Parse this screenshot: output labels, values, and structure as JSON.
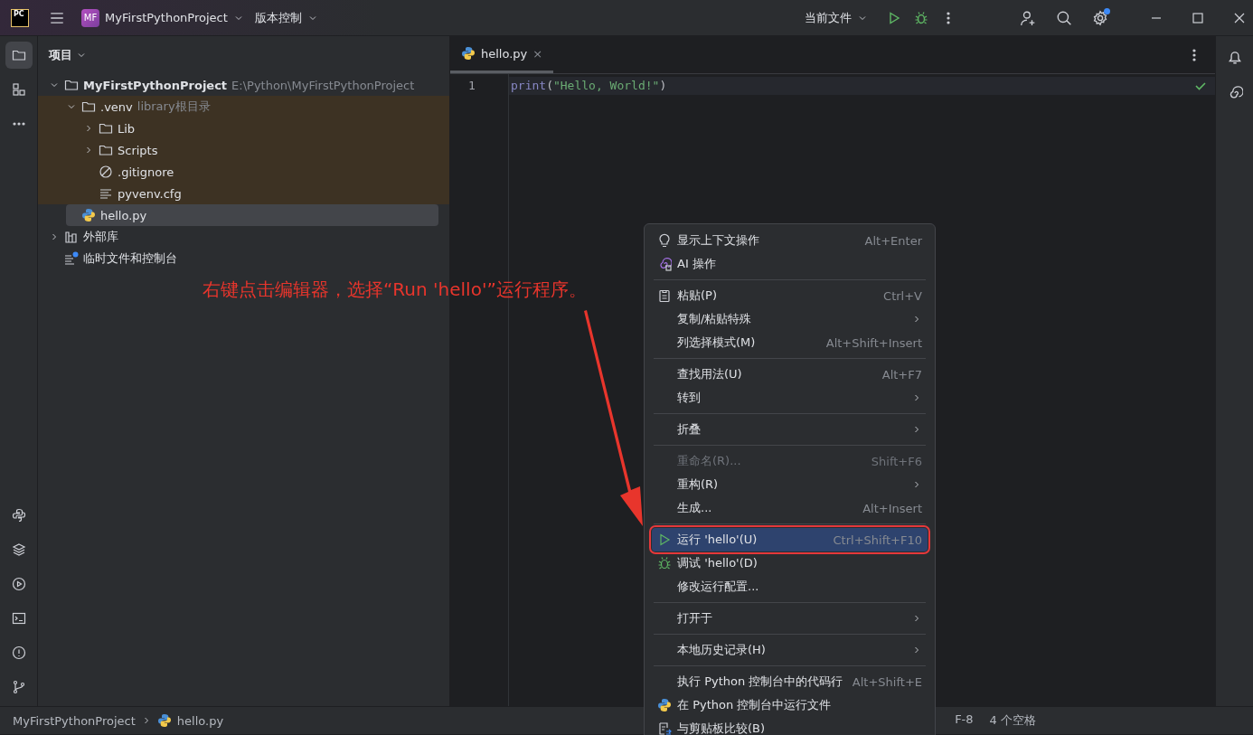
{
  "title_bar": {
    "app_logo": "PC",
    "project_badge": "MF",
    "project": "MyFirstPythonProject",
    "vcs": "版本控制",
    "run_config": "当前文件",
    "settings_badge": true
  },
  "project_panel": {
    "title": "项目",
    "tree": [
      {
        "name": "MyFirstPythonProject",
        "note": "E:\\Python\\MyFirstPythonProject",
        "kind": "project",
        "expanded": true,
        "selected": false,
        "children": [
          {
            "name": ".venv",
            "note": "library根目录",
            "kind": "folder",
            "expanded": true,
            "selected": false,
            "excluded": true,
            "children": [
              {
                "name": "Lib",
                "kind": "folder",
                "expanded": false,
                "selected": false
              },
              {
                "name": "Scripts",
                "kind": "folder",
                "expanded": false,
                "selected": false
              },
              {
                "name": ".gitignore",
                "kind": "ignore",
                "selected": false
              },
              {
                "name": "pyvenv.cfg",
                "kind": "text",
                "selected": false
              }
            ]
          },
          {
            "name": "hello.py",
            "kind": "python",
            "selected": true
          }
        ]
      },
      {
        "name": "外部库",
        "kind": "library",
        "expanded": false,
        "selected": false
      },
      {
        "name": "临时文件和控制台",
        "kind": "scratch",
        "selected": false
      }
    ]
  },
  "editor": {
    "tabs": [
      {
        "label": "hello.py",
        "close": "×",
        "selected": true
      }
    ],
    "lines": [
      {
        "number": "1",
        "tokens": [
          {
            "text": "print",
            "kind": "builtin"
          },
          {
            "text": "(",
            "kind": "plain"
          },
          {
            "text": "\"Hello, World!\"",
            "kind": "string"
          },
          {
            "text": ")",
            "kind": "plain"
          }
        ]
      }
    ]
  },
  "context_menu": {
    "items": [
      {
        "kind": "hint",
        "label": "显示上下文操作",
        "shortcut": "Alt+Enter",
        "submenu": false,
        "disabled": false,
        "selected": false
      },
      {
        "kind": "ai",
        "label": "AI 操作",
        "submenu": false,
        "disabled": false,
        "selected": false
      },
      {
        "kind": "separator"
      },
      {
        "kind": "paste",
        "label": "粘贴(P)",
        "shortcut": "Ctrl+V",
        "submenu": false,
        "disabled": false,
        "selected": false
      },
      {
        "kind": "plain",
        "label": "复制/粘贴特殊",
        "submenu": true,
        "disabled": false,
        "selected": false
      },
      {
        "kind": "plain",
        "label": "列选择模式(M)",
        "shortcut": "Alt+Shift+Insert",
        "submenu": false,
        "disabled": false,
        "selected": false
      },
      {
        "kind": "separator"
      },
      {
        "kind": "plain",
        "label": "查找用法(U)",
        "shortcut": "Alt+F7",
        "submenu": false,
        "disabled": false,
        "selected": false
      },
      {
        "kind": "plain",
        "label": "转到",
        "submenu": true,
        "disabled": false,
        "selected": false
      },
      {
        "kind": "separator"
      },
      {
        "kind": "plain",
        "label": "折叠",
        "submenu": true,
        "disabled": false,
        "selected": false
      },
      {
        "kind": "separator"
      },
      {
        "kind": "plain",
        "label": "重命名(R)...",
        "shortcut": "Shift+F6",
        "submenu": false,
        "disabled": true,
        "selected": false
      },
      {
        "kind": "plain",
        "label": "重构(R)",
        "submenu": true,
        "disabled": false,
        "selected": false
      },
      {
        "kind": "plain",
        "label": "生成...",
        "shortcut": "Alt+Insert",
        "submenu": false,
        "disabled": false,
        "selected": false
      },
      {
        "kind": "separator"
      },
      {
        "kind": "run",
        "label": "运行 'hello'(U)",
        "shortcut": "Ctrl+Shift+F10",
        "submenu": false,
        "disabled": false,
        "selected": true
      },
      {
        "kind": "debug",
        "label": "调试 'hello'(D)",
        "submenu": false,
        "disabled": false,
        "selected": false
      },
      {
        "kind": "plain",
        "label": "修改运行配置...",
        "submenu": false,
        "disabled": false,
        "selected": false
      },
      {
        "kind": "separator"
      },
      {
        "kind": "plain",
        "label": "打开于",
        "submenu": true,
        "disabled": false,
        "selected": false
      },
      {
        "kind": "separator"
      },
      {
        "kind": "plain",
        "label": "本地历史记录(H)",
        "submenu": true,
        "disabled": false,
        "selected": false
      },
      {
        "kind": "separator"
      },
      {
        "kind": "plain",
        "label": "执行 Python 控制台中的代码行",
        "shortcut": "Alt+Shift+E",
        "submenu": false,
        "disabled": false,
        "selected": false
      },
      {
        "kind": "python",
        "label": "在 Python 控制台中运行文件",
        "submenu": false,
        "disabled": false,
        "selected": false
      },
      {
        "kind": "compare",
        "label": "与剪贴板比较(B)",
        "submenu": false,
        "disabled": false,
        "selected": false
      }
    ]
  },
  "annotation": {
    "text": "右键点击编辑器，选择“Run 'hello'”运行程序。"
  },
  "status_bar": {
    "breadcrumbs": [
      {
        "label": "MyFirstPythonProject",
        "kind": "folder"
      },
      {
        "label": "hello.py",
        "kind": "python"
      }
    ],
    "items": [
      "F-8",
      "4 个空格"
    ]
  }
}
